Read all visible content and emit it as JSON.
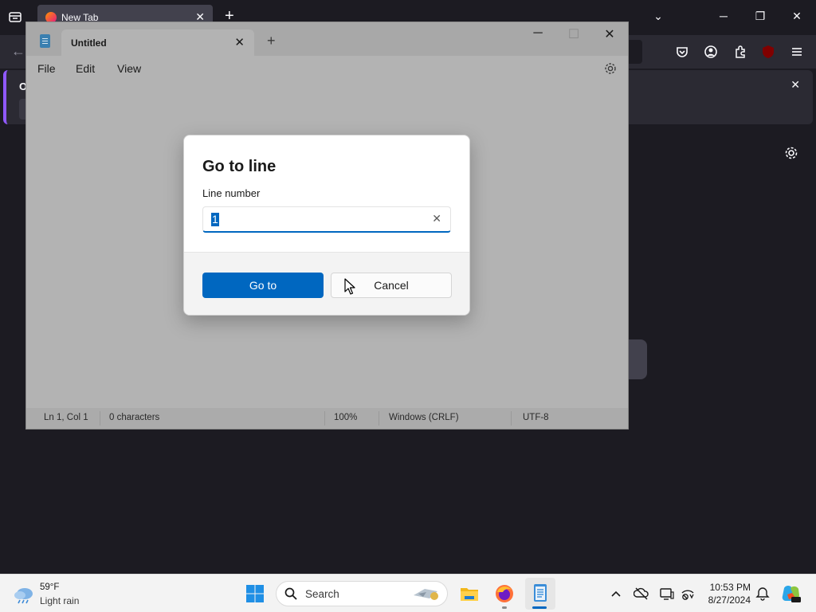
{
  "browser": {
    "tab_title": "New Tab",
    "notification_text": "O"
  },
  "notepad": {
    "tab_title": "Untitled",
    "menu": [
      "File",
      "Edit",
      "View"
    ],
    "status": {
      "position": "Ln 1, Col 1",
      "characters": "0 characters",
      "zoom": "100%",
      "line_ending": "Windows (CRLF)",
      "encoding": "UTF-8"
    }
  },
  "dialog": {
    "title": "Go to line",
    "field_label": "Line number",
    "field_value": "1",
    "go_label": "Go to",
    "cancel_label": "Cancel"
  },
  "taskbar": {
    "weather_temp": "59°F",
    "weather_condition": "Light rain",
    "search_placeholder": "Search",
    "time": "10:53 PM",
    "date": "8/27/2024"
  },
  "colors": {
    "accent": "#0067c0",
    "firefox_bg": "#1c1b22",
    "overlay_gray": "#b3b3b3"
  }
}
